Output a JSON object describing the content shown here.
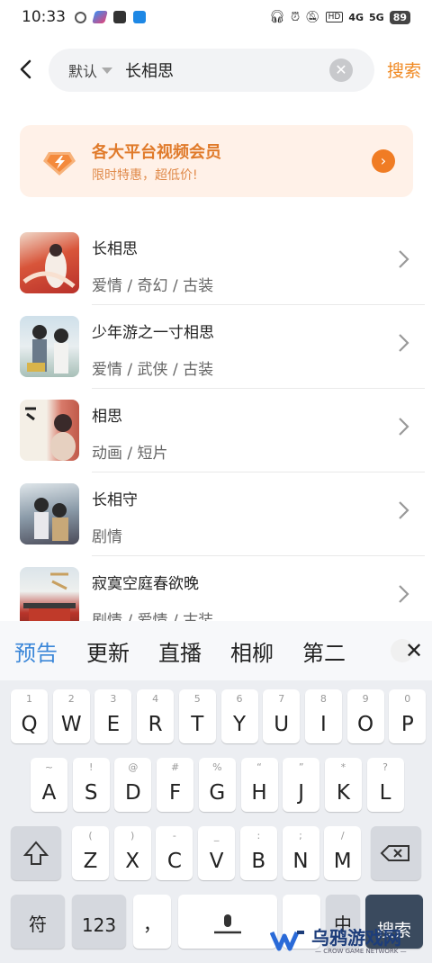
{
  "status": {
    "time": "10:33",
    "battery": "89",
    "net1": "HD",
    "net2": "4G",
    "net3": "5G"
  },
  "search": {
    "filter": "默认",
    "query": "长相思",
    "submit": "搜索"
  },
  "banner": {
    "title": "各大平台视频会员",
    "subtitle": "限时特惠，超低价!"
  },
  "results": [
    {
      "title": "长相思",
      "tags": "爱情  /  奇幻  /  古装"
    },
    {
      "title": "少年游之一寸相思",
      "tags": "爱情  /  武侠  /  古装"
    },
    {
      "title": "相思",
      "tags": "动画  /  短片"
    },
    {
      "title": "长相守",
      "tags": "剧情"
    },
    {
      "title": "寂寞空庭春欲晚",
      "tags": "剧情  /  爱情  /  古装"
    }
  ],
  "keyboard": {
    "suggestions": [
      "预告",
      "更新",
      "直播",
      "相柳",
      "第二"
    ],
    "row1": [
      [
        "1",
        "Q"
      ],
      [
        "2",
        "W"
      ],
      [
        "3",
        "E"
      ],
      [
        "4",
        "R"
      ],
      [
        "5",
        "T"
      ],
      [
        "6",
        "Y"
      ],
      [
        "7",
        "U"
      ],
      [
        "8",
        "I"
      ],
      [
        "9",
        "O"
      ],
      [
        "0",
        "P"
      ]
    ],
    "row2": [
      [
        "~",
        "A"
      ],
      [
        "!",
        "S"
      ],
      [
        "@",
        "D"
      ],
      [
        "#",
        "F"
      ],
      [
        "%",
        "G"
      ],
      [
        "“",
        "H"
      ],
      [
        "”",
        "J"
      ],
      [
        "*",
        "K"
      ],
      [
        "?",
        "L"
      ]
    ],
    "row3": [
      [
        "(",
        "Z"
      ],
      [
        ")",
        "X"
      ],
      [
        "-",
        "C"
      ],
      [
        "_",
        "V"
      ],
      [
        ":",
        "B"
      ],
      [
        ";",
        "N"
      ],
      [
        "/",
        "M"
      ]
    ],
    "sym": "符",
    "num": "123",
    "comma": "，",
    "lang": "中",
    "go": "搜索"
  },
  "watermark": {
    "brand": "乌鸦游戏网",
    "en": "— CROW GAME NETWORK —"
  }
}
